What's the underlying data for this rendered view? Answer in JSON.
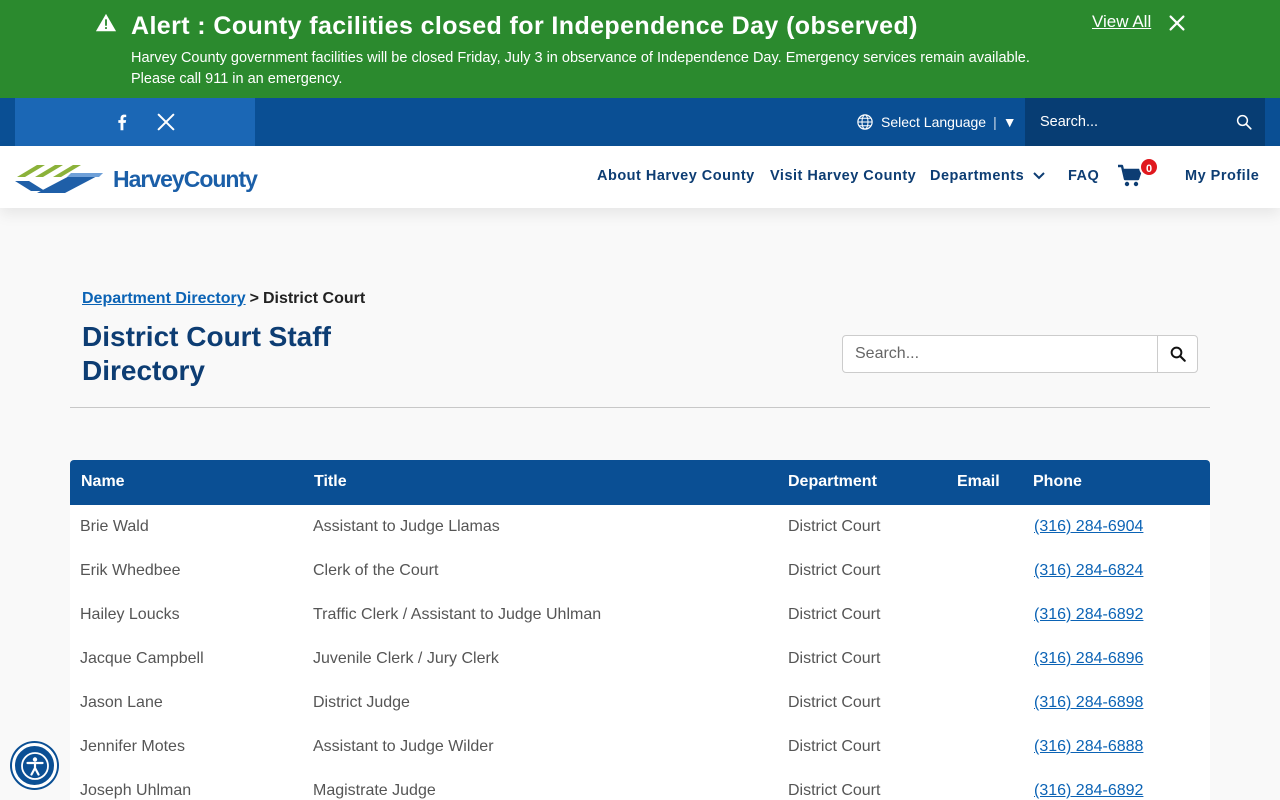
{
  "alert": {
    "title": "Alert : County facilities closed for Independence Day (observed)",
    "body": "Harvey County government facilities will be closed Friday, July 3 in observance of Independence Day. Emergency services remain available. Please call 911 in an emergency.",
    "view_all": "View All",
    "icon": "warning-icon",
    "color": "#2b8a2e"
  },
  "utility": {
    "language_label": "Select Language",
    "language_caret": "▼",
    "search_placeholder": "Search...",
    "color": "#0a4f94"
  },
  "header": {
    "logo_text": "HarveyCounty",
    "nav": [
      "About Harvey County",
      "Visit Harvey County",
      "Departments",
      "FAQ",
      "My Profile"
    ],
    "cart_count": "0"
  },
  "breadcrumb": {
    "parent": "Department Directory",
    "separator": ">",
    "current": "District Court"
  },
  "page_title": "District Court Staff Directory",
  "directory_search": {
    "placeholder": "Search..."
  },
  "table": {
    "columns": [
      "Name",
      "Title",
      "Department",
      "Email",
      "Phone"
    ],
    "rows": [
      [
        "Brie Wald",
        "Assistant to Judge Llamas",
        "District Court",
        "",
        "(316) 284-6904"
      ],
      [
        "Erik Whedbee",
        "Clerk of the Court",
        "District Court",
        "",
        "(316) 284-6824"
      ],
      [
        "Hailey Loucks",
        "Traffic Clerk / Assistant to Judge Uhlman",
        "District Court",
        "",
        "(316) 284-6892"
      ],
      [
        "Jacque Campbell",
        "Juvenile Clerk / Jury Clerk",
        "District Court",
        "",
        "(316) 284-6896"
      ],
      [
        "Jason Lane",
        "District Judge",
        "District Court",
        "",
        "(316) 284-6898"
      ],
      [
        "Jennifer Motes",
        "Assistant to Judge Wilder",
        "District Court",
        "",
        "(316) 284-6888"
      ],
      [
        "Joseph Uhlman",
        "Magistrate Judge",
        "District Court",
        "",
        "(316) 284-6892"
      ]
    ]
  }
}
